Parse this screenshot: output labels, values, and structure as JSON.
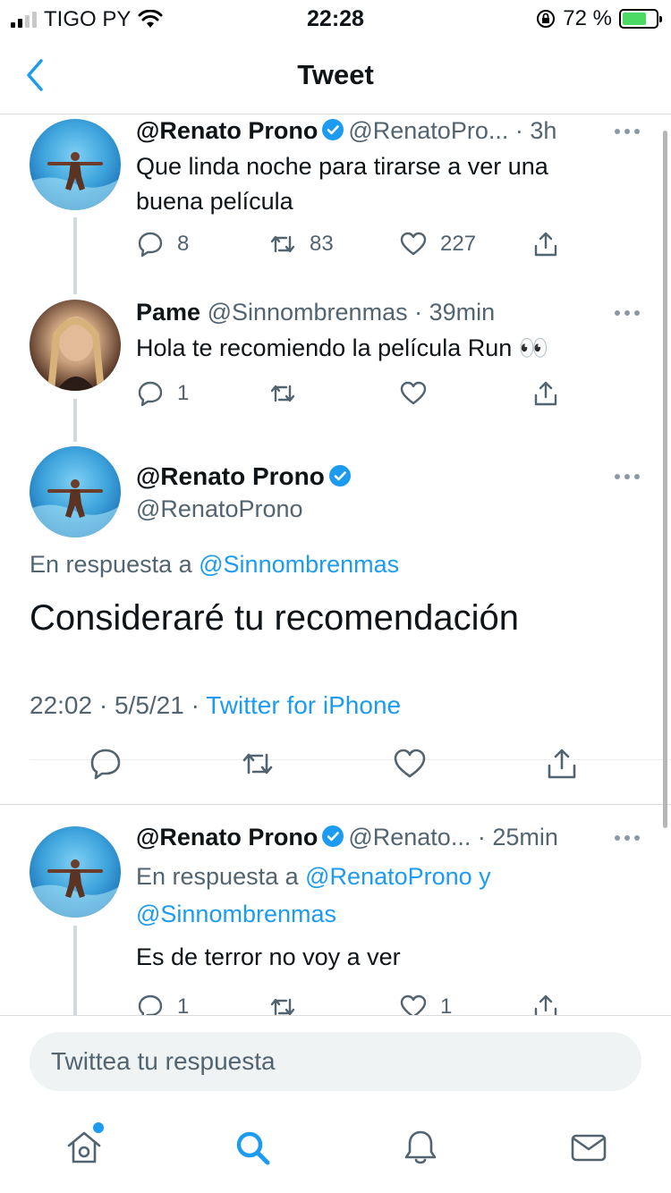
{
  "status_bar": {
    "carrier": "TIGO PY",
    "time": "22:28",
    "battery_pct": "72 %",
    "battery_level": 0.72
  },
  "nav": {
    "title": "Tweet"
  },
  "tweets": [
    {
      "name": "@Renato Prono",
      "handle": "@RenatoPro...",
      "time": "· 3h",
      "text_line1": "Que linda noche para tirarse a ver una",
      "text_line2": "buena película",
      "replies": "8",
      "retweets": "83",
      "likes": "227"
    },
    {
      "name": "Pame",
      "handle": "@Sinnombrenmas",
      "time": "· 39min",
      "text": "Hola te recomiendo la película Run 👀",
      "replies": "1",
      "retweets": "",
      "likes": ""
    }
  ],
  "focused": {
    "name": "@Renato Prono",
    "handle": "@RenatoProno",
    "reply_prefix": "En respuesta a",
    "reply_mention": "@Sinnombrenmas",
    "text": "Consideraré tu recomendación",
    "time": "22:02",
    "date": "5/5/21",
    "source": "Twitter for iPhone"
  },
  "reply": {
    "name": "@Renato Prono",
    "handle": "@Renato...",
    "time": "· 25min",
    "reply_prefix": "En respuesta a",
    "mention1": "@RenatoProno y",
    "mention2": "@Sinnombrenmas",
    "text": "Es de terror no voy a ver",
    "replies": "1",
    "likes": "1"
  },
  "composer": {
    "placeholder": "Twittea tu respuesta"
  },
  "colors": {
    "accent": "#1d9bf0",
    "muted": "#536471",
    "text": "#0f1419"
  },
  "tabs": [
    "home-icon",
    "search-icon",
    "notifications-icon",
    "messages-icon"
  ]
}
